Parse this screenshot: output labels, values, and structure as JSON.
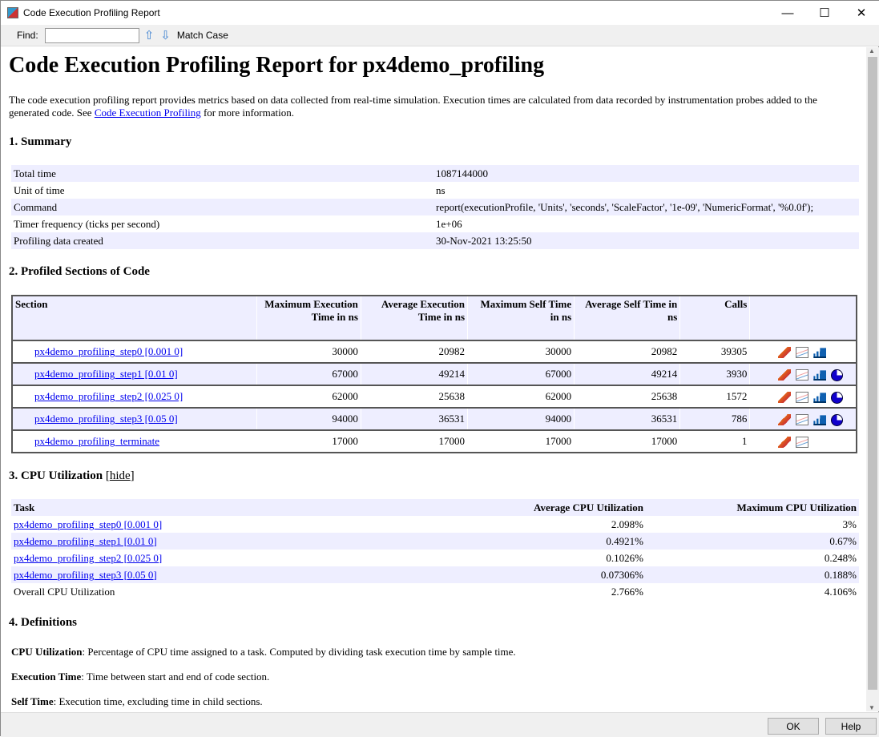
{
  "window": {
    "title": "Code Execution Profiling Report",
    "minimize": "—",
    "maximize": "☐",
    "close": "✕"
  },
  "toolbar": {
    "find_label": "Find:",
    "find_value": "",
    "match_case": "Match Case"
  },
  "report": {
    "title": "Code Execution Profiling Report for px4demo_profiling",
    "intro_before": "The code execution profiling report provides metrics based on data collected from real-time simulation. Execution times are calculated from data recorded by instrumentation probes added to the generated code. See ",
    "intro_link": "Code Execution Profiling",
    "intro_after": " for more information.",
    "summary": {
      "heading": "1. Summary",
      "rows": [
        {
          "label": "Total time",
          "value": "1087144000"
        },
        {
          "label": "Unit of time",
          "value": "ns"
        },
        {
          "label": "Command",
          "value": "report(executionProfile, 'Units', 'seconds', 'ScaleFactor', '1e-09', 'NumericFormat', '%0.0f');"
        },
        {
          "label": "Timer frequency (ticks per second)",
          "value": "1e+06"
        },
        {
          "label": "Profiling data created",
          "value": "30-Nov-2021 13:25:50"
        }
      ]
    },
    "sections": {
      "heading": "2. Profiled Sections of Code",
      "columns": [
        "Section",
        "Maximum Execution Time in ns",
        "Average Execution Time in ns",
        "Maximum Self Time in ns",
        "Average Self Time in ns",
        "Calls",
        ""
      ],
      "rows": [
        {
          "name": "px4demo_profiling_step0 [0.001 0]",
          "max_exec": "30000",
          "avg_exec": "20982",
          "max_self": "30000",
          "avg_self": "20982",
          "calls": "39305",
          "icons": [
            "matlab-icon",
            "line-plot-icon",
            "bar-chart-icon"
          ]
        },
        {
          "name": "px4demo_profiling_step1 [0.01 0]",
          "max_exec": "67000",
          "avg_exec": "49214",
          "max_self": "67000",
          "avg_self": "49214",
          "calls": "3930",
          "icons": [
            "matlab-icon",
            "line-plot-icon",
            "bar-chart-icon",
            "pie-chart-icon"
          ]
        },
        {
          "name": "px4demo_profiling_step2 [0.025 0]",
          "max_exec": "62000",
          "avg_exec": "25638",
          "max_self": "62000",
          "avg_self": "25638",
          "calls": "1572",
          "icons": [
            "matlab-icon",
            "line-plot-icon",
            "bar-chart-icon",
            "pie-chart-icon"
          ]
        },
        {
          "name": "px4demo_profiling_step3 [0.05 0]",
          "max_exec": "94000",
          "avg_exec": "36531",
          "max_self": "94000",
          "avg_self": "36531",
          "calls": "786",
          "icons": [
            "matlab-icon",
            "line-plot-icon",
            "bar-chart-icon",
            "pie-chart-icon"
          ]
        },
        {
          "name": "px4demo_profiling_terminate",
          "max_exec": "17000",
          "avg_exec": "17000",
          "max_self": "17000",
          "avg_self": "17000",
          "calls": "1",
          "icons": [
            "matlab-icon",
            "line-plot-icon"
          ]
        }
      ]
    },
    "cpu": {
      "heading": "3. CPU Utilization",
      "hide_link": "hide",
      "columns": [
        "Task",
        "Average CPU Utilization",
        "Maximum CPU Utilization"
      ],
      "rows": [
        {
          "task": "px4demo_profiling_step0 [0.001 0]",
          "avg": "2.098%",
          "max": "3%",
          "link": true
        },
        {
          "task": "px4demo_profiling_step1 [0.01 0]",
          "avg": "0.4921%",
          "max": "0.67%",
          "link": true
        },
        {
          "task": "px4demo_profiling_step2 [0.025 0]",
          "avg": "0.1026%",
          "max": "0.248%",
          "link": true
        },
        {
          "task": "px4demo_profiling_step3 [0.05 0]",
          "avg": "0.07306%",
          "max": "0.188%",
          "link": true
        },
        {
          "task": "Overall CPU Utilization",
          "avg": "2.766%",
          "max": "4.106%",
          "link": false
        }
      ]
    },
    "definitions": {
      "heading": "4. Definitions",
      "items": [
        {
          "term": "CPU Utilization",
          "text": ": Percentage of CPU time assigned to a task. Computed by dividing task execution time by sample time."
        },
        {
          "term": "Execution Time",
          "text": ": Time between start and end of code section."
        },
        {
          "term": "Self Time",
          "text": ": Execution time, excluding time in child sections."
        }
      ]
    }
  },
  "buttons": {
    "ok": "OK",
    "help": "Help"
  }
}
